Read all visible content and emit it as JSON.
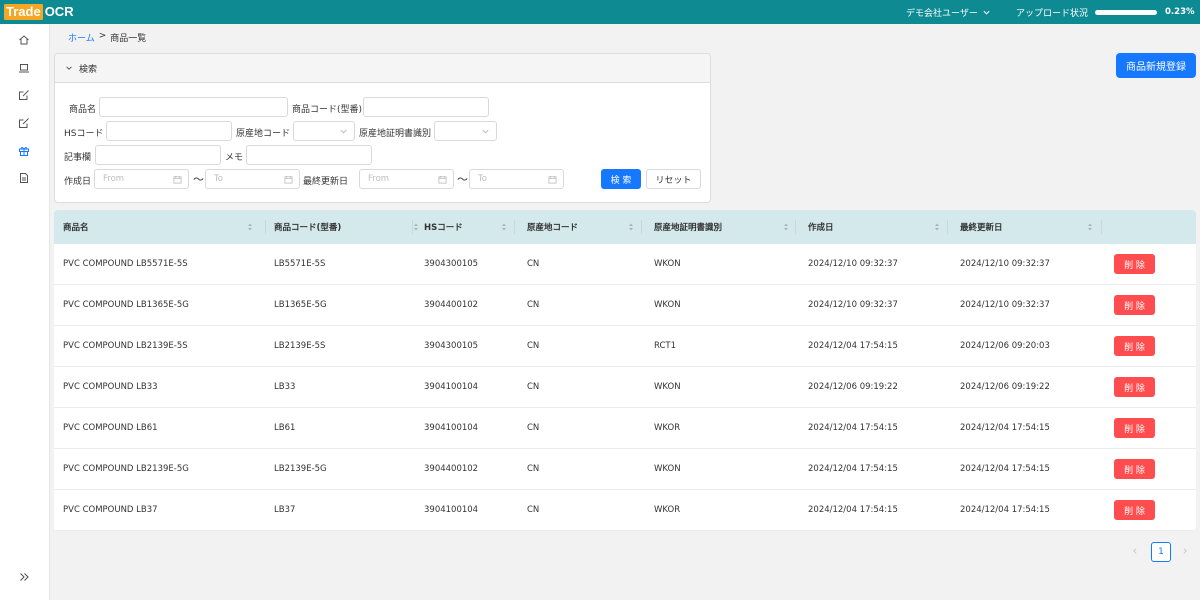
{
  "header": {
    "logo_trade": "Trade",
    "logo_ocr": "OCR",
    "user_name": "デモ会社ユーザー",
    "upload_label": "アップロード状況",
    "upload_progress": 0.23,
    "upload_progress_text": "0.23%",
    "color": "#0e8a93"
  },
  "sidebar": {
    "items": [
      "home-icon",
      "laptop-icon",
      "edit-icon",
      "edit-icon",
      "gift-icon",
      "file-icon"
    ],
    "collapse_icon": "double-chevron-right-icon"
  },
  "breadcrumb": {
    "home": "ホーム",
    "sep": ">",
    "current": "商品一覧"
  },
  "search": {
    "title": "検索",
    "product_name_label": "商品名",
    "product_code_label": "商品コード(型番)",
    "hs_code_label": "HSコード",
    "origin_code_label": "原産地コード",
    "origin_cert_label": "原産地証明書識別",
    "notes_label": "記事欄",
    "memo_label": "メモ",
    "created_label": "作成日",
    "updated_label": "最終更新日",
    "from_placeholder": "From",
    "to_placeholder": "To",
    "tilde": "～",
    "search_button": "検 索",
    "reset_button": "リセット"
  },
  "new_button": "商品新規登録",
  "table": {
    "headers": [
      "商品名",
      "商品コード(型番)",
      "HSコード",
      "原産地コード",
      "原産地証明書識別",
      "作成日",
      "最終更新日"
    ],
    "delete_label": "削 除",
    "rows": [
      [
        "PVC COMPOUND LB5571E-5S",
        "LB5571E-5S",
        "3904300105",
        "CN",
        "WKON",
        "2024/12/10 09:32:37",
        "2024/12/10 09:32:37"
      ],
      [
        "PVC COMPOUND LB1365E-5G",
        "LB1365E-5G",
        "3904400102",
        "CN",
        "WKON",
        "2024/12/10 09:32:37",
        "2024/12/10 09:32:37"
      ],
      [
        "PVC COMPOUND LB2139E-5S",
        "LB2139E-5S",
        "3904300105",
        "CN",
        "RCT1",
        "2024/12/04 17:54:15",
        "2024/12/06 09:20:03"
      ],
      [
        "PVC COMPOUND LB33",
        "LB33",
        "3904100104",
        "CN",
        "WKON",
        "2024/12/06 09:19:22",
        "2024/12/06 09:19:22"
      ],
      [
        "PVC COMPOUND LB61",
        "LB61",
        "3904100104",
        "CN",
        "WKOR",
        "2024/12/04 17:54:15",
        "2024/12/04 17:54:15"
      ],
      [
        "PVC COMPOUND LB2139E-5G",
        "LB2139E-5G",
        "3904400102",
        "CN",
        "WKON",
        "2024/12/04 17:54:15",
        "2024/12/04 17:54:15"
      ],
      [
        "PVC COMPOUND LB37",
        "LB37",
        "3904100104",
        "CN",
        "WKOR",
        "2024/12/04 17:54:15",
        "2024/12/04 17:54:15"
      ]
    ]
  },
  "pagination": {
    "current": "1"
  }
}
